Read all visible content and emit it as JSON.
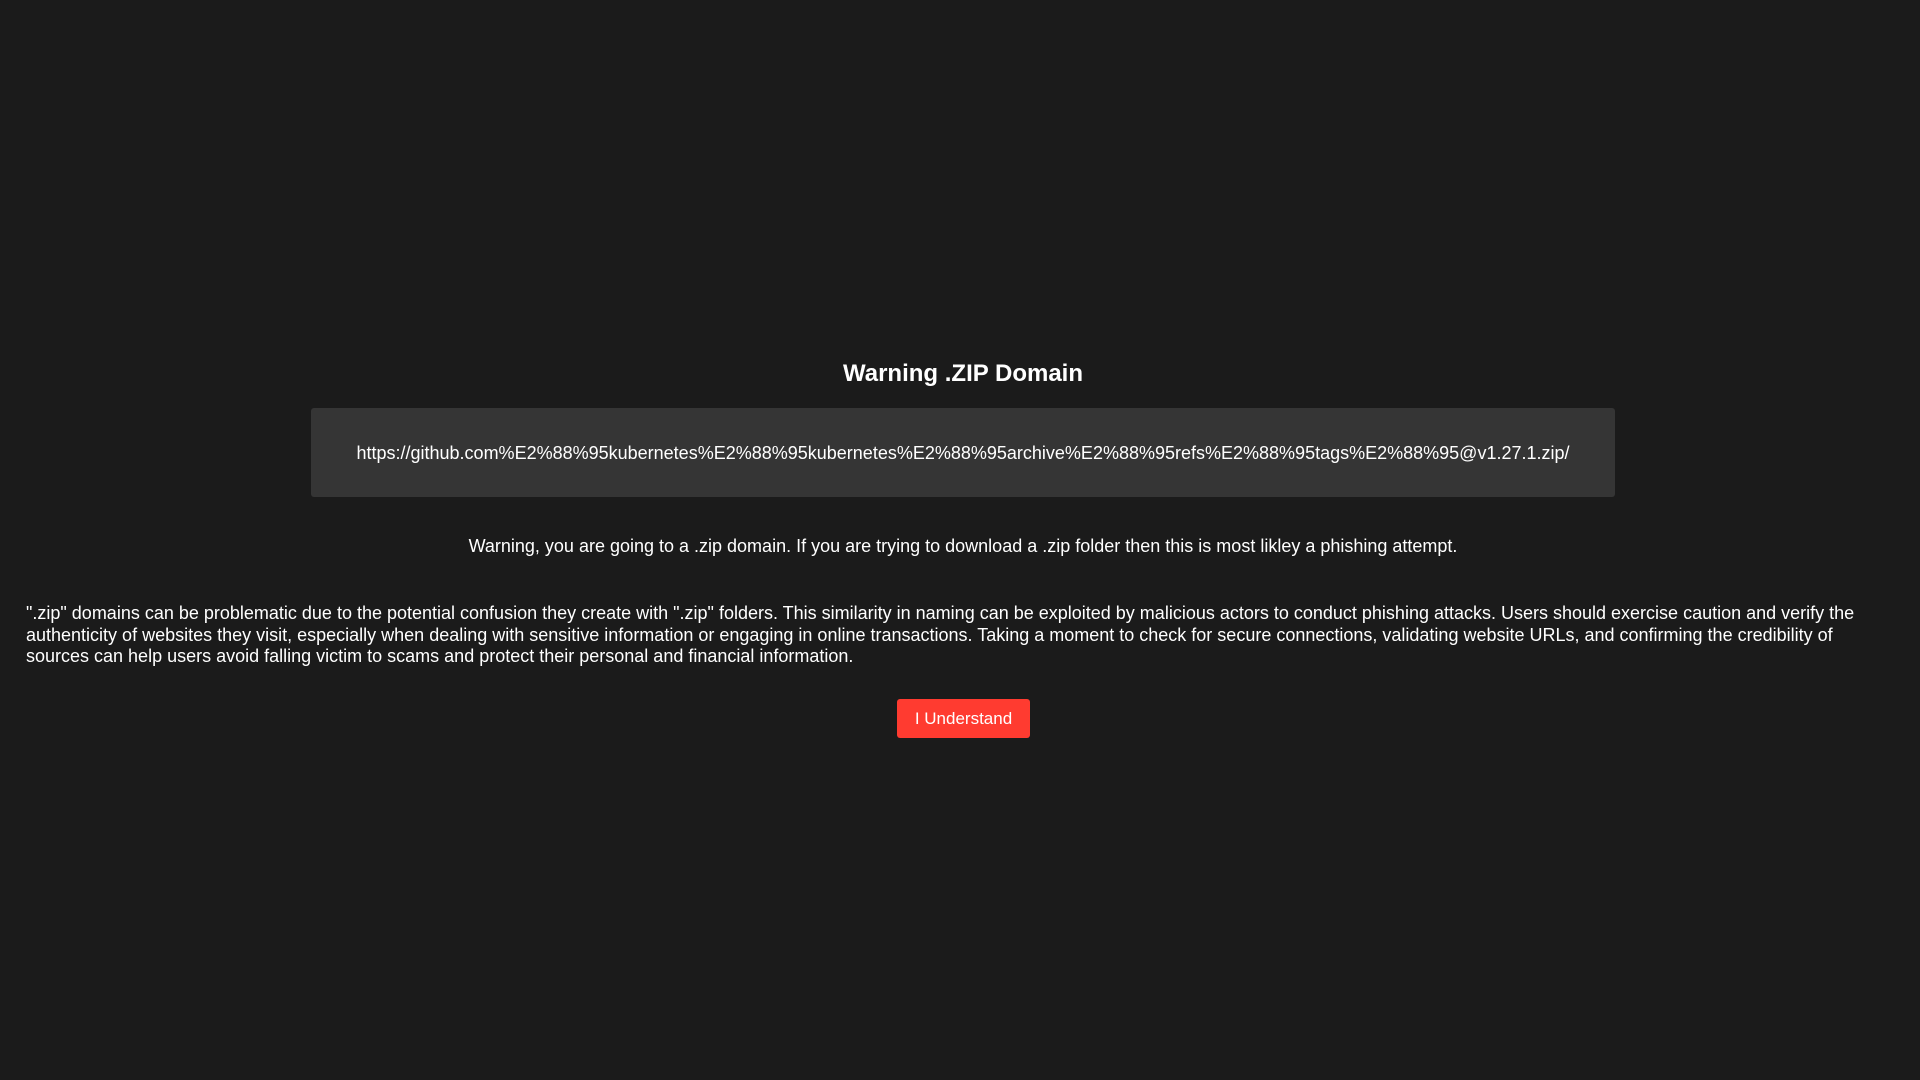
{
  "dialog": {
    "title": "Warning .ZIP Domain",
    "url": "https://github.com%E2%88%95kubernetes%E2%88%95kubernetes%E2%88%95archive%E2%88%95refs%E2%88%95tags%E2%88%95@v1.27.1.zip/",
    "warning": "Warning, you are going to a .zip domain. If you are trying to download a .zip folder then this is most likley a phishing attempt.",
    "explanation": "\".zip\" domains can be problematic due to the potential confusion they create with \".zip\" folders. This similarity in naming can be exploited by malicious actors to conduct phishing attacks. Users should exercise caution and verify the authenticity of websites they visit, especially when dealing with sensitive information or engaging in online transactions. Taking a moment to check for secure connections, validating website URLs, and confirming the credibility of sources can help users avoid falling victim to scams and protect their personal and financial information.",
    "confirm_label": "I Understand"
  },
  "colors": {
    "background": "#1b1b1b",
    "url_box": "#353535",
    "button": "#ff3b30",
    "text": "#ffffff"
  }
}
